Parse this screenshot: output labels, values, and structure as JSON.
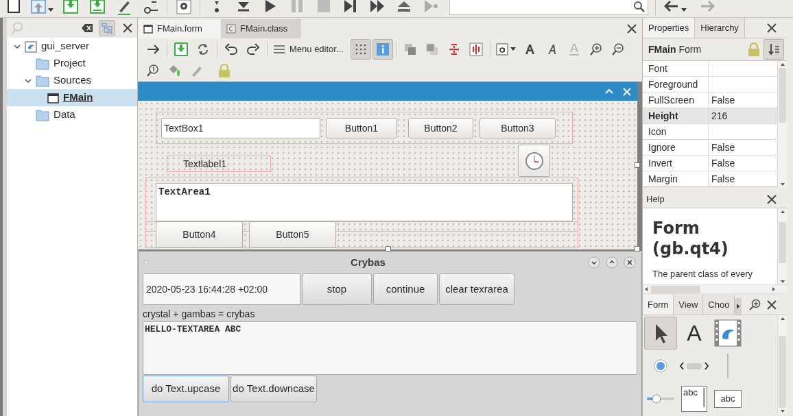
{
  "project_panel": {
    "tree": [
      {
        "label": "gui_server",
        "kind": "project",
        "selected": false,
        "expanded": true,
        "children": [
          {
            "label": "Project",
            "kind": "folder",
            "selected": false
          },
          {
            "label": "Sources",
            "kind": "folder",
            "selected": false,
            "expanded": true,
            "children": [
              {
                "label": "FMain",
                "kind": "form",
                "selected": true
              }
            ]
          },
          {
            "label": "Data",
            "kind": "folder",
            "selected": false
          }
        ]
      }
    ]
  },
  "editor_tabs": [
    {
      "label": "FMain.form",
      "kind": "form",
      "selected": true
    },
    {
      "label": "FMain.class",
      "kind": "class",
      "selected": false
    }
  ],
  "form_toolbar": {
    "menu_editor": "Menu editor...",
    "grid_toggle": true,
    "info_toggle": true
  },
  "form_designer": {
    "controls": [
      {
        "kind": "textbox",
        "text": "TextBox1"
      },
      {
        "kind": "button",
        "text": "Button1"
      },
      {
        "kind": "button",
        "text": "Button2"
      },
      {
        "kind": "button",
        "text": "Button3"
      },
      {
        "kind": "label",
        "text": "Textlabel1"
      },
      {
        "kind": "timer"
      },
      {
        "kind": "textarea",
        "text": "TextArea1"
      },
      {
        "kind": "button",
        "text": "Button4"
      },
      {
        "kind": "button",
        "text": "Button5"
      }
    ]
  },
  "running_window": {
    "title": "Crybas",
    "datetime": "2020-05-23 16:44:28 +02:00",
    "top_buttons": [
      "stop",
      "continue",
      "clear texrarea"
    ],
    "caption": "crystal + gambas = crybas",
    "textarea": "HELLO-TEXTAREA ABC",
    "bottom_buttons": [
      {
        "label": "do Text.upcase",
        "focused": true
      },
      {
        "label": "do Text.downcase",
        "focused": false
      }
    ]
  },
  "properties_panel": {
    "tabs": [
      {
        "label": "Properties",
        "selected": true
      },
      {
        "label": "Hierarchy",
        "selected": false
      }
    ],
    "object_name": "FMain",
    "object_class": "Form",
    "rows": [
      {
        "name": "Font",
        "modified": false
      },
      {
        "name": "Foreground",
        "modified": false
      },
      {
        "name": "FullScreen",
        "value": "False",
        "modified": false
      },
      {
        "name": "Height",
        "value": "216",
        "modified": true
      },
      {
        "name": "Icon",
        "modified": false
      },
      {
        "name": "Ignore",
        "value": "False",
        "modified": false
      },
      {
        "name": "Invert",
        "value": "False",
        "modified": false
      },
      {
        "name": "Margin",
        "value": "False",
        "modified": false
      }
    ]
  },
  "help_panel": {
    "title": "Help",
    "heading": "Form (gb.qt4)",
    "text": "The parent class of every"
  },
  "toolbox": {
    "tabs": [
      {
        "label": "Form",
        "selected": true
      },
      {
        "label": "View",
        "selected": false
      },
      {
        "label": "Choo",
        "selected": false
      }
    ],
    "tools": [
      {
        "kind": "pointer",
        "selected": true
      },
      {
        "kind": "label",
        "text": "A",
        "selected": false
      },
      {
        "kind": "movie",
        "selected": false
      },
      {
        "kind": "radio",
        "selected": false
      },
      {
        "kind": "scroll",
        "selected": false
      },
      {
        "kind": "separator",
        "selected": false
      },
      {
        "kind": "slider",
        "selected": false
      },
      {
        "kind": "textarea",
        "text": "abc",
        "selected": false
      },
      {
        "kind": "textbox",
        "text": "abc",
        "selected": false
      }
    ]
  }
}
